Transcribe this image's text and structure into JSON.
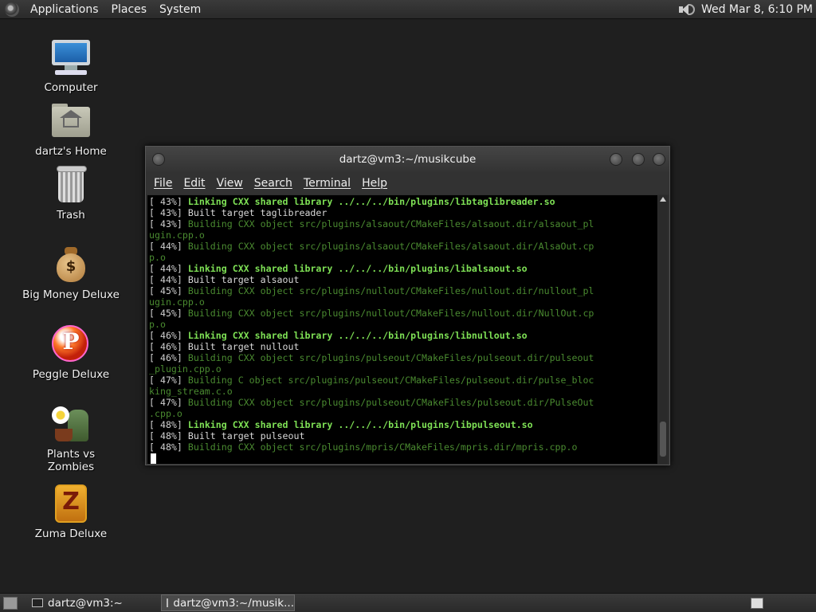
{
  "top_panel": {
    "menus": [
      "Applications",
      "Places",
      "System"
    ],
    "clock": "Wed Mar  8,  6:10 PM"
  },
  "desktop_icons": [
    {
      "label": "Computer",
      "icon": "computer-icon"
    },
    {
      "label": "dartz's Home",
      "icon": "home-folder-icon"
    },
    {
      "label": "Trash",
      "icon": "trash-icon"
    },
    {
      "label": "Big Money Deluxe",
      "icon": "big-money-icon"
    },
    {
      "label": "Peggle Deluxe",
      "icon": "peggle-icon"
    },
    {
      "label": "Plants vs Zombies",
      "icon": "plants-vs-zombies-icon"
    },
    {
      "label": "Zuma Deluxe",
      "icon": "zuma-icon"
    }
  ],
  "terminal": {
    "title": "dartz@vm3:~/musikcube",
    "menu": [
      "File",
      "Edit",
      "View",
      "Search",
      "Terminal",
      "Help"
    ],
    "lines": [
      {
        "pct": "[ 43%]",
        "text": "Linking CXX shared library ../../../bin/plugins/libtaglibreader.so",
        "style": "link"
      },
      {
        "pct": "[ 43%]",
        "text": "Built target taglibreader",
        "style": "built"
      },
      {
        "pct": "[ 43%]",
        "text": "Building CXX object src/plugins/alsaout/CMakeFiles/alsaout.dir/alsaout_pl",
        "style": "dim"
      },
      {
        "pct": "",
        "text": "ugin.cpp.o",
        "style": "dim"
      },
      {
        "pct": "[ 44%]",
        "text": "Building CXX object src/plugins/alsaout/CMakeFiles/alsaout.dir/AlsaOut.cp",
        "style": "dim"
      },
      {
        "pct": "",
        "text": "p.o",
        "style": "dim"
      },
      {
        "pct": "[ 44%]",
        "text": "Linking CXX shared library ../../../bin/plugins/libalsaout.so",
        "style": "link"
      },
      {
        "pct": "[ 44%]",
        "text": "Built target alsaout",
        "style": "built"
      },
      {
        "pct": "[ 45%]",
        "text": "Building CXX object src/plugins/nullout/CMakeFiles/nullout.dir/nullout_pl",
        "style": "dim"
      },
      {
        "pct": "",
        "text": "ugin.cpp.o",
        "style": "dim"
      },
      {
        "pct": "[ 45%]",
        "text": "Building CXX object src/plugins/nullout/CMakeFiles/nullout.dir/NullOut.cp",
        "style": "dim"
      },
      {
        "pct": "",
        "text": "p.o",
        "style": "dim"
      },
      {
        "pct": "[ 46%]",
        "text": "Linking CXX shared library ../../../bin/plugins/libnullout.so",
        "style": "link"
      },
      {
        "pct": "[ 46%]",
        "text": "Built target nullout",
        "style": "built"
      },
      {
        "pct": "[ 46%]",
        "text": "Building CXX object src/plugins/pulseout/CMakeFiles/pulseout.dir/pulseout",
        "style": "dim"
      },
      {
        "pct": "",
        "text": "_plugin.cpp.o",
        "style": "dim"
      },
      {
        "pct": "[ 47%]",
        "text": "Building C object src/plugins/pulseout/CMakeFiles/pulseout.dir/pulse_bloc",
        "style": "dim"
      },
      {
        "pct": "",
        "text": "king_stream.c.o",
        "style": "dim"
      },
      {
        "pct": "[ 47%]",
        "text": "Building CXX object src/plugins/pulseout/CMakeFiles/pulseout.dir/PulseOut",
        "style": "dim"
      },
      {
        "pct": "",
        "text": ".cpp.o",
        "style": "dim"
      },
      {
        "pct": "[ 48%]",
        "text": "Linking CXX shared library ../../../bin/plugins/libpulseout.so",
        "style": "link"
      },
      {
        "pct": "[ 48%]",
        "text": "Built target pulseout",
        "style": "built"
      },
      {
        "pct": "[ 48%]",
        "text": "Building CXX object src/plugins/mpris/CMakeFiles/mpris.dir/mpris.cpp.o",
        "style": "dim"
      }
    ]
  },
  "taskbar": {
    "tasks": [
      "dartz@vm3:~",
      "dartz@vm3:~/musik..."
    ]
  },
  "colors": {
    "link_green": "#7ee055",
    "dim_green": "#4a8a30",
    "panel": "#333333",
    "desktop": "#1f1f1f"
  }
}
